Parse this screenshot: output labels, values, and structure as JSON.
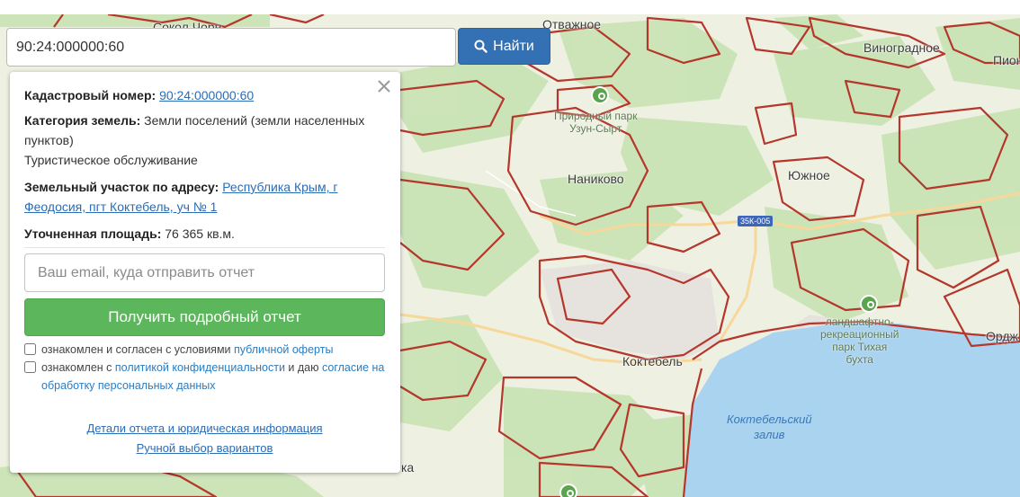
{
  "search": {
    "value": "90:24:000000:60",
    "button_label": "Найти"
  },
  "map": {
    "labels": {
      "top_left": "Сокол Чорн...",
      "otvazhnoe": "Отважное",
      "vinogradnoe": "Виноградное",
      "pion": "Пион",
      "park_uzun": "Природный парк\nУзун-Сырт",
      "nanikovo": "Наниково",
      "yuzhnoe": "Южное",
      "road": "35К-005",
      "landscape_park": "ландшафтно-\nрекреационный\nпарк Тихая\nбухта",
      "koktebel": "Коктебель",
      "ordzh": "Ордж",
      "bay": "Коктебельский\nзалив",
      "bottom_ka": "ка"
    }
  },
  "card": {
    "cadastral_label": "Кадастровый номер:",
    "cadastral_value": "90:24:000000:60",
    "category_label": "Категория земель:",
    "category_value": "Земли поселений (земли населенных пунктов)",
    "category_extra": "Туристическое обслуживание",
    "address_label": "Земельный участок по адресу:",
    "address_value": "Республика Крым, г Феодосия, пгт Коктебель, уч № 1",
    "area_label": "Уточненная площадь:",
    "area_value": "76 365 кв.м.",
    "email_placeholder": "Ваш email, куда отправить отчет",
    "report_button": "Получить подробный отчет",
    "consent1_text": "ознакомлен и согласен с условиями ",
    "consent1_link": "публичной оферты",
    "consent2_text": "ознакомлен с ",
    "consent2_link": "политикой конфиденциальности",
    "consent2_text2": " и даю ",
    "consent2_link2": "согласие на обработку персональных данных",
    "footer_link1": "Детали отчета и юридическая информация",
    "footer_link2": "Ручной выбор вариантов"
  },
  "colors": {
    "map_bg": "#eef0e2",
    "green": "#c8e2b4",
    "sea": "#a9d3ef",
    "parcel": "#b5362b",
    "search_button": "#3470b4",
    "report_button": "#5cb65c"
  }
}
